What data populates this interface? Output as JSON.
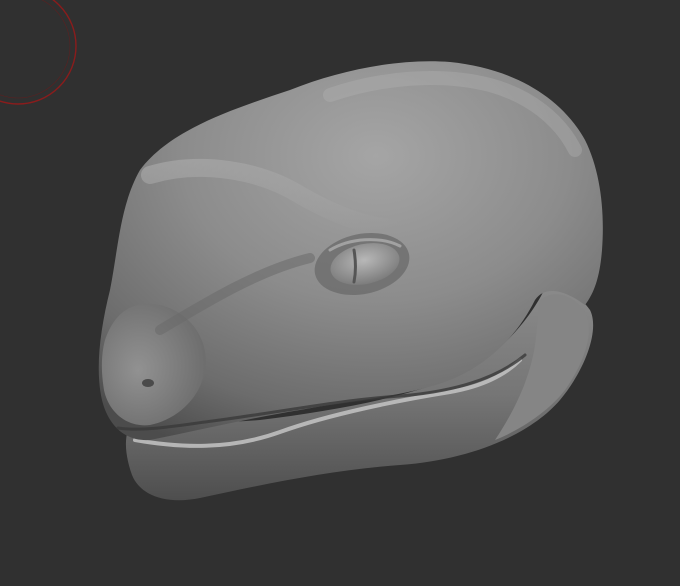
{
  "viewport": {
    "background_color": "#303030",
    "brush_cursor_color": "#8a1c1c",
    "mesh_base_color": "#8f8f8f"
  },
  "brush_cursor": {
    "icon": "brush-radius-icon"
  },
  "model": {
    "icon": "sculpted-reptile-head-model"
  }
}
